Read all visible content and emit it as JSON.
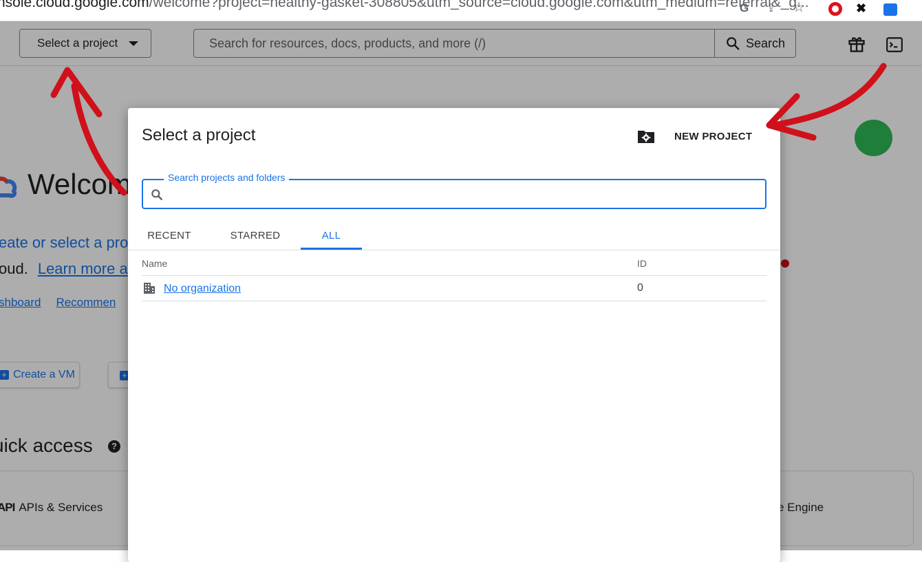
{
  "browser": {
    "url_host": "nsole.cloud.google.com",
    "url_path": "/welcome?project=healthy-gasket-308805&utm_source=cloud.google.com&utm_medium=referral&_g..."
  },
  "header": {
    "project_picker_label": "Select a project",
    "search_placeholder": "Search for resources, docs, products, and more (/)",
    "search_button_label": "Search"
  },
  "background": {
    "welcome_title": "Welcom",
    "line1": "eate or select a pro",
    "line2_text": "oud.",
    "line2_link": "Learn more a",
    "links": [
      "shboard",
      "Recommen"
    ],
    "create_vm_label": "Create a VM",
    "quick_access_title": "uick access",
    "help_glyph": "?",
    "apis_glyph": "API",
    "apis_label": "APIs & Services",
    "engine_label": "e Engine"
  },
  "dialog": {
    "title": "Select a project",
    "new_project_label": "NEW PROJECT",
    "search_label": "Search projects and folders",
    "search_value": "",
    "tabs": [
      {
        "label": "RECENT",
        "active": false
      },
      {
        "label": "STARRED",
        "active": false
      },
      {
        "label": "ALL",
        "active": true
      }
    ],
    "table": {
      "columns": [
        "Name",
        "ID"
      ],
      "rows": [
        {
          "name": "No organization",
          "id": "0"
        }
      ]
    }
  },
  "colors": {
    "accent": "#1a73e8",
    "annotation_red": "#d0101a",
    "annotation_green": "#1e7e3a",
    "scrim": "rgba(0,0,0,0.32)"
  },
  "icons": {
    "project_caret": "caret-down-icon",
    "search": "search-icon",
    "gift": "gift-icon",
    "terminal": "terminal-icon",
    "new_project": "folder-gear-icon",
    "org": "building-icon"
  }
}
